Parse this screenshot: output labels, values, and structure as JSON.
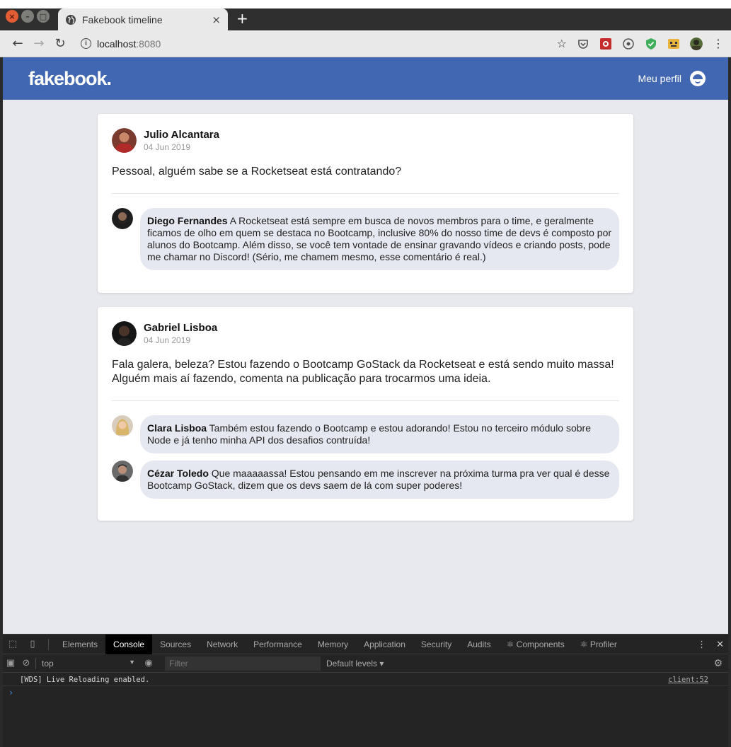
{
  "browser": {
    "tab_title": "Fakebook timeline",
    "tab_close": "×",
    "new_tab": "+",
    "url_host": "localhost",
    "url_port": ":8080",
    "info_symbol": "i",
    "back": "←",
    "forward": "→",
    "reload": "↻",
    "star": "☆",
    "menu": "⋮"
  },
  "app": {
    "logo": "fakebook.",
    "profile_label": "Meu perfil"
  },
  "posts": [
    {
      "author": "Julio Alcantara",
      "date": "04 Jun 2019",
      "content": "Pessoal, alguém sabe se a Rocketseat está contratando?",
      "comments": [
        {
          "author": "Diego Fernandes",
          "content": "A Rocketseat está sempre em busca de novos membros para o time, e geralmente ficamos de olho em quem se destaca no Bootcamp, inclusive 80% do nosso time de devs é composto por alunos do Bootcamp. Além disso, se você tem vontade de ensinar gravando vídeos e criando posts, pode me chamar no Discord! (Sério, me chamem mesmo, esse comentário é real.)"
        }
      ]
    },
    {
      "author": "Gabriel Lisboa",
      "date": "04 Jun 2019",
      "content": "Fala galera, beleza? Estou fazendo o Bootcamp GoStack da Rocketseat e está sendo muito massa! Alguém mais aí fazendo, comenta na publicação para trocarmos uma ideia.",
      "comments": [
        {
          "author": "Clara Lisboa",
          "content": "Também estou fazendo o Bootcamp e estou adorando! Estou no terceiro módulo sobre Node e já tenho minha API dos desafios contruída!"
        },
        {
          "author": "Cézar Toledo",
          "content": "Que maaaaassa! Estou pensando em me inscrever na próxima turma pra ver qual é desse Bootcamp GoStack, dizem que os devs saem de lá com super poderes!"
        }
      ]
    }
  ],
  "devtools": {
    "tabs": [
      "Elements",
      "Console",
      "Sources",
      "Network",
      "Performance",
      "Memory",
      "Application",
      "Security",
      "Audits",
      "⚛ Components",
      "⚛ Profiler"
    ],
    "context": "top",
    "filter_placeholder": "Filter",
    "levels": "Default levels ▾",
    "log_message": "[WDS] Live Reloading enabled.",
    "log_source": "client:52",
    "prompt": "›"
  },
  "colors": {
    "brand": "#4267b2",
    "page_bg": "#e8e9ee",
    "bubble_bg": "#e5e8f0"
  }
}
